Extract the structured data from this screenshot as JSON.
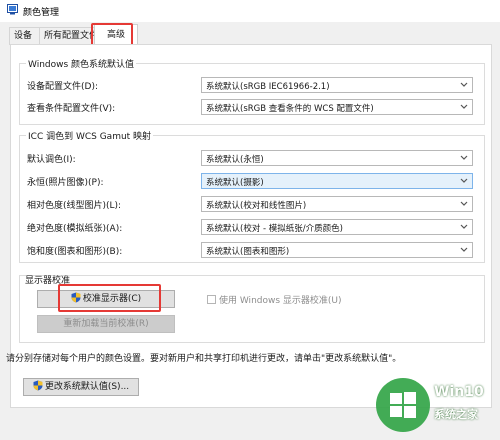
{
  "window": {
    "title": "颜色管理"
  },
  "tabs": [
    {
      "label": "设备"
    },
    {
      "label": "所有配置文件"
    },
    {
      "label": "高级"
    }
  ],
  "windows_defaults": {
    "title": "Windows 颜色系统默认值",
    "rows": [
      {
        "label": "设备配置文件(D):",
        "value": "系统默认(sRGB IEC61966-2.1)"
      },
      {
        "label": "查看条件配置文件(V):",
        "value": "系统默认(sRGB 查看条件的 WCS 配置文件)"
      }
    ]
  },
  "gamut": {
    "title": "ICC 调色到 WCS Gamut 映射",
    "rows": [
      {
        "label": "默认调色(I):",
        "value": "系统默认(永恒)"
      },
      {
        "label": "永恒(照片图像)(P):",
        "value": "系统默认(摄影)"
      },
      {
        "label": "相对色度(线型图片)(L):",
        "value": "系统默认(校对和线性图片)"
      },
      {
        "label": "绝对色度(模拟纸张)(A):",
        "value": "系统默认(校对 - 模拟纸张/介质颜色)"
      },
      {
        "label": "饱和度(图表和图形)(B):",
        "value": "系统默认(图表和图形)"
      }
    ]
  },
  "calibration": {
    "title": "显示器校准",
    "calibrate_button": "校准显示器(C)",
    "use_windows_calibration": "使用 Windows 显示器校准(U)",
    "reload_button": "重新加载当前校准(R)"
  },
  "footer": {
    "note": "请分别存储对每个用户的颜色设置。要对新用户和共享打印机进行更改，请单击\"更改系统默认值\"。",
    "change_defaults_button": "更改系统默认值(S)..."
  },
  "watermark": {
    "line1": "Win10",
    "line2": "系统之家"
  },
  "colors": {
    "highlight_box": "#e53935",
    "select_highlight": "#e5f1fb",
    "watermark_green": "#2fa344"
  }
}
